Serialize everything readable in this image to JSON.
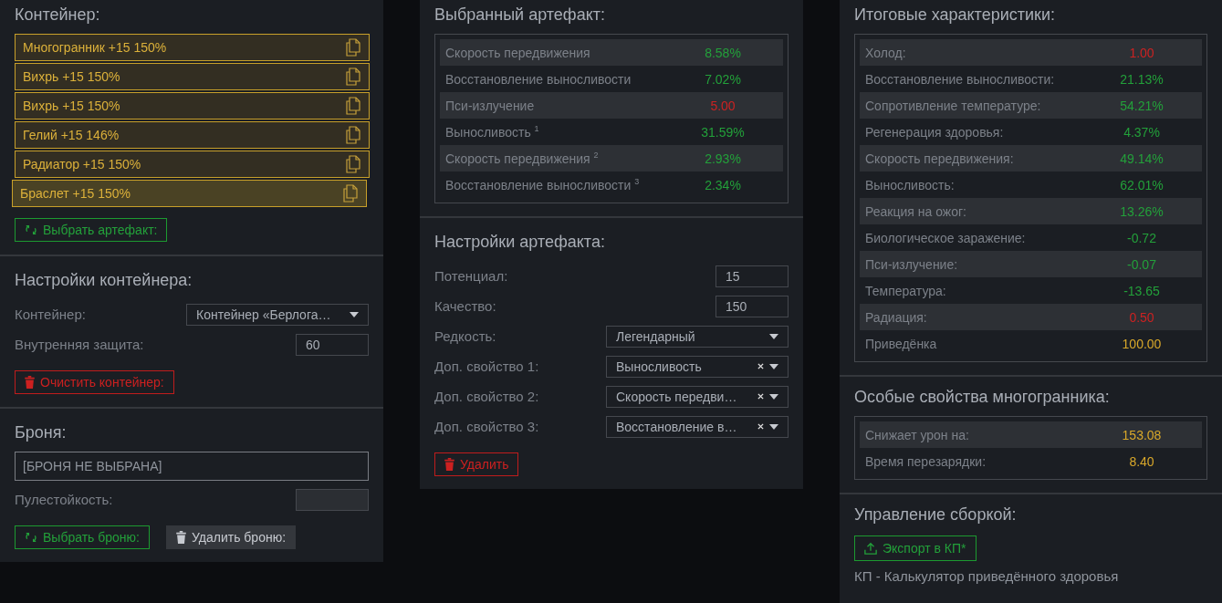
{
  "container": {
    "title": "Контейнер:",
    "slots": [
      {
        "label": "Многогранник +15 150%",
        "selected": false
      },
      {
        "label": "Вихрь +15 150%",
        "selected": false
      },
      {
        "label": "Вихрь +15 150%",
        "selected": false
      },
      {
        "label": "Гелий +15 146%",
        "selected": false
      },
      {
        "label": "Радиатор +15 150%",
        "selected": false
      },
      {
        "label": "Браслет +15 150%",
        "selected": true
      }
    ],
    "buttons": [
      {
        "label": "Выбрать артефакт:",
        "kind": "success"
      }
    ]
  },
  "container_settings": {
    "title": "Настройки контейнера:",
    "fields": [
      {
        "kind": "select",
        "label": "Контейнер:",
        "value": "Контейнер «Берлога…",
        "clearable": false
      },
      {
        "kind": "input",
        "label": "Внутренняя защита:",
        "value": "60",
        "disabled": false
      }
    ],
    "buttons": [
      {
        "label": "Очистить контейнер:",
        "kind": "danger"
      }
    ]
  },
  "armor": {
    "title": "Броня:",
    "armor_name": "[БРОНЯ НЕ ВЫБРАНА]",
    "fields": [
      {
        "kind": "input",
        "label": "Пулестойкость:",
        "disabled": true
      }
    ],
    "buttons": [
      {
        "label": "Выбрать броню:",
        "kind": "success"
      },
      {
        "label": "Удалить броню:",
        "kind": "secondary"
      }
    ]
  },
  "selected_artifact": {
    "title": "Выбранный артефакт:",
    "stats": [
      {
        "label": "Скорость передвижения",
        "value": "8.58%",
        "color": "#23a03a"
      },
      {
        "label": "Восстановление выносливости",
        "value": "7.02%",
        "color": "#23a03a"
      },
      {
        "label": "Пси-излучение",
        "value": "5.00",
        "color": "#cc2222"
      },
      {
        "label": "Выносливость $^{1}$",
        "value": "31.59%",
        "color": "#23a03a"
      },
      {
        "label": "Скорость передвижения $^{2}$",
        "value": "2.93%",
        "color": "#23a03a"
      },
      {
        "label": "Восстановление выносливости $^{3}$",
        "value": "2.34%",
        "color": "#23a03a"
      }
    ]
  },
  "artifact_settings": {
    "title": "Настройки артефакта:",
    "fields": [
      {
        "kind": "input",
        "label": "Потенциал:",
        "value": "15",
        "disabled": false
      },
      {
        "kind": "input",
        "label": "Качество:",
        "value": "150",
        "disabled": false
      },
      {
        "kind": "select",
        "label": "Редкость:",
        "value": "Легендарный",
        "clearable": false
      },
      {
        "kind": "select",
        "label": "Доп. свойство 1:",
        "value": "Выносливость",
        "clearable": true
      },
      {
        "kind": "select",
        "label": "Доп. свойство 2:",
        "value": "Скорость передви…",
        "clearable": true
      },
      {
        "kind": "select",
        "label": "Доп. свойство 3:",
        "value": "Восстановление в…",
        "clearable": true
      }
    ],
    "buttons": [
      {
        "label": "Удалить",
        "kind": "danger"
      }
    ]
  },
  "total_stats": {
    "title": "Итоговые характеристики:",
    "stats": [
      {
        "label": "Холод:",
        "value": "1.00",
        "color": "#cc2222"
      },
      {
        "label": "Восстановление выносливости:",
        "value": "21.13%",
        "color": "#23a03a"
      },
      {
        "label": "Сопротивление температуре:",
        "value": "54.21%",
        "color": "#23a03a"
      },
      {
        "label": "Регенерация здоровья:",
        "value": "4.37%",
        "color": "#23a03a"
      },
      {
        "label": "Скорость передвижения:",
        "value": "49.14%",
        "color": "#23a03a"
      },
      {
        "label": "Выносливость:",
        "value": "62.01%",
        "color": "#23a03a"
      },
      {
        "label": "Реакция на ожог:",
        "value": "13.26%",
        "color": "#23a03a"
      },
      {
        "label": "Биологическое заражение:",
        "value": "-0.72",
        "color": "#23a03a"
      },
      {
        "label": "Пси-излучение:",
        "value": "-0.07",
        "color": "#23a03a"
      },
      {
        "label": "Температура:",
        "value": "-13.65",
        "color": "#23a03a"
      },
      {
        "label": "Радиация:",
        "value": "0.50",
        "color": "#cc2222"
      },
      {
        "label": "Приведёнка",
        "value": "100.00",
        "color": "#d9a82a"
      }
    ]
  },
  "special_properties": {
    "title": "Особые свойства многогранника:",
    "stats": [
      {
        "label": "Снижает урон на:",
        "value": "153.08",
        "color": "#d9a82a"
      },
      {
        "label": "Время перезарядки:",
        "value": "8.40",
        "color": "#d9a82a"
      }
    ]
  },
  "build_management": {
    "title": "Управление сборкой:",
    "buttons": [
      {
        "label": "Экспорт в КП*",
        "kind": "export"
      }
    ],
    "note": "КП - Калькулятор приведённого здоровья"
  }
}
